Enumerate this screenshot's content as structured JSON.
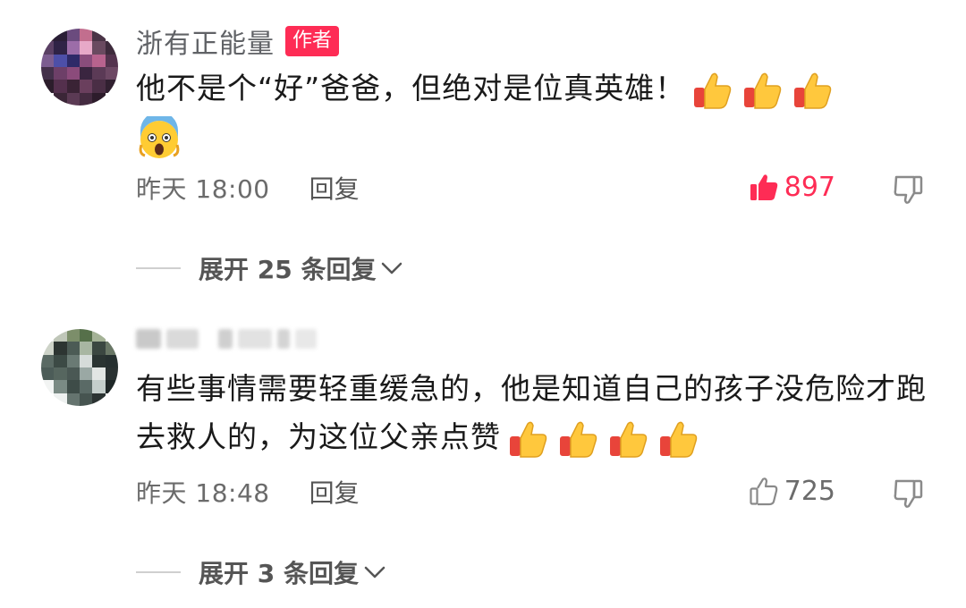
{
  "comments": [
    {
      "author": "浙有正能量",
      "badge": "作者",
      "text": "他不是个“好”爸爸，但绝对是位真英雄！",
      "emojis": [
        "thumbs-up-icon",
        "thumbs-up-icon",
        "thumbs-up-icon",
        "screaming-face-icon"
      ],
      "time": "昨天 18:00",
      "reply_label": "回复",
      "likes": "897",
      "liked": true,
      "expand_label": "展开 25 条回复"
    },
    {
      "author": "",
      "text": "有些事情需要轻重缓急的，他是知道自己的孩子没危险才跑去救人的，为这位父亲点赞",
      "emojis": [
        "thumbs-up-icon",
        "thumbs-up-icon",
        "thumbs-up-icon",
        "thumbs-up-icon"
      ],
      "time": "昨天 18:48",
      "reply_label": "回复",
      "likes": "725",
      "liked": false,
      "expand_label": "展开 3 条回复"
    }
  ],
  "colors": {
    "accent": "#fe2c55",
    "text_primary": "#1a1a1a",
    "text_secondary": "#6b6b6b",
    "thumb_yellow": "#ffc83d",
    "thumb_red": "#e8443a"
  }
}
